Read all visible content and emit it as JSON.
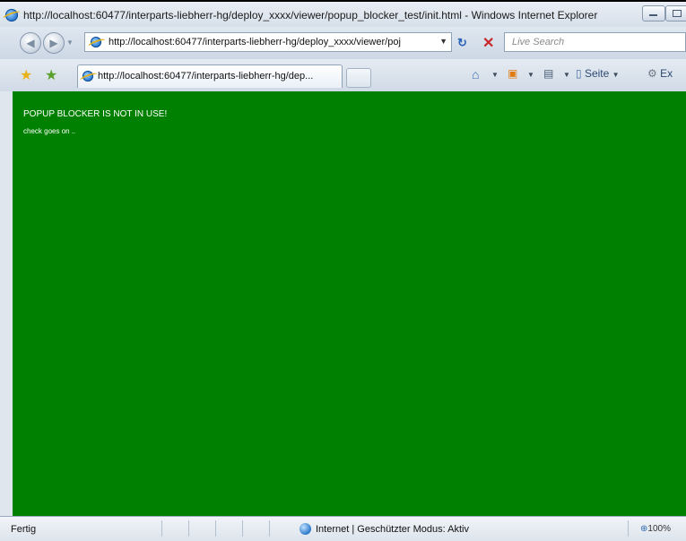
{
  "window": {
    "title": "http://localhost:60477/interparts-liebherr-hg/deploy_xxxx/viewer/popup_blocker_test/init.html - Windows Internet Explorer"
  },
  "address_bar": {
    "url": "http://localhost:60477/interparts-liebherr-hg/deploy_xxxx/viewer/poj"
  },
  "search": {
    "placeholder": "Live Search"
  },
  "tabs": [
    {
      "label": "http://localhost:60477/interparts-liebherr-hg/dep..."
    }
  ],
  "toolbar": {
    "page_label": "Seite",
    "extras_label": "Ex"
  },
  "page": {
    "background_color": "#008000",
    "line1": "POPUP BLOCKER IS NOT IN USE!",
    "line2": "check goes on .."
  },
  "statusbar": {
    "status": "Fertig",
    "zone": "Internet | Geschützter Modus: Aktiv",
    "zoom": "100%"
  },
  "icons": [
    "ie-icon",
    "back-icon",
    "forward-icon",
    "refresh-icon",
    "stop-icon",
    "favorites-star-icon",
    "add-favorites-icon",
    "home-icon",
    "feeds-icon",
    "print-icon",
    "page-icon",
    "tools-icon",
    "globe-icon",
    "zoom-icon"
  ]
}
